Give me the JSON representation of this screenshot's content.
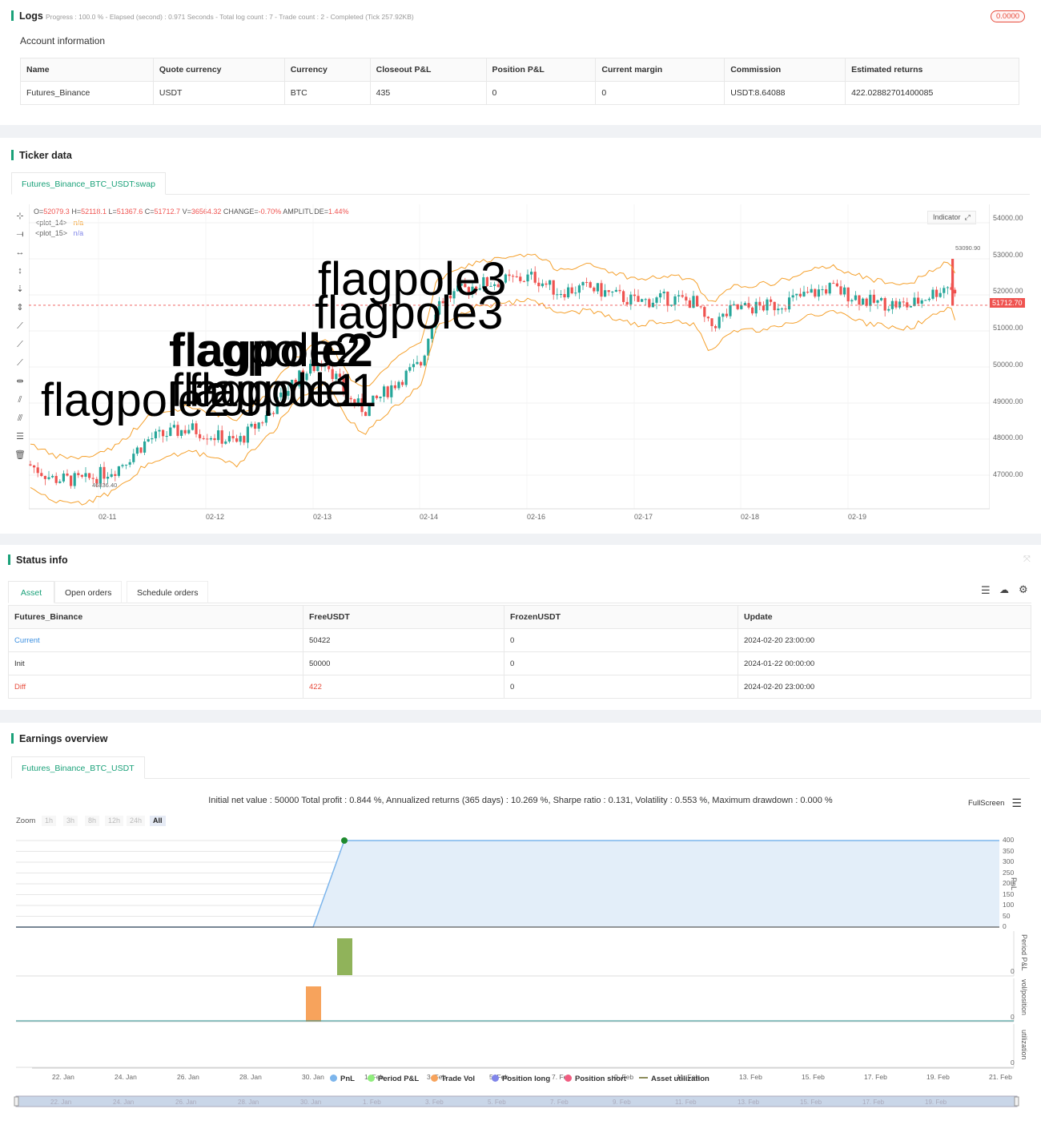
{
  "logs": {
    "title": "Logs",
    "progress": "Progress : 100.0 % - Elapsed (second) : 0.971 Seconds - Total log count : 7 - Trade count : 2 - Completed (Tick 257.92KB)",
    "badge": "0.0000"
  },
  "account": {
    "title": "Account information",
    "headers": [
      "Name",
      "Quote currency",
      "Currency",
      "Closeout P&L",
      "Position P&L",
      "Current margin",
      "Commission",
      "Estimated returns"
    ],
    "row": [
      "Futures_Binance",
      "USDT",
      "BTC",
      "435",
      "0",
      "0",
      "USDT:8.64088",
      "422.02882701400085"
    ]
  },
  "ticker": {
    "title": "Ticker data",
    "tab": "Futures_Binance_BTC_USDT:swap",
    "ohlc": {
      "prefix_o": "O=",
      "o": "52079.3",
      "prefix_h": " H=",
      "h": "52118.1",
      "prefix_l": " L=",
      "l": "51367.6",
      "prefix_c": " C=",
      "c": "51712.7",
      "prefix_v": " V=",
      "v": "36564.32",
      "prefix_change": " CHANGE=",
      "change": "-0.70%",
      "prefix_amp": " AMPLITUDE=",
      "amp": "1.44%"
    },
    "plots": [
      {
        "name": "<plot_14>",
        "value": "n/a"
      },
      {
        "name": "<plot_15>",
        "value": "n/a"
      }
    ],
    "indicator_btn": "Indicator",
    "price_ticks": [
      "54000.00",
      "53000.00",
      "52000.00",
      "51000.00",
      "50000.00",
      "49000.00",
      "48000.00",
      "47000.00"
    ],
    "last_price": "51712.70",
    "high_mark": "53090.90",
    "low_mark": "46836.40",
    "date_ticks": [
      "02-11",
      "02-12",
      "02-13",
      "02-14",
      "02-16",
      "02-17",
      "02-18",
      "02-19"
    ],
    "annotations": [
      "flagpole3",
      "flagpole3",
      "flagpole2",
      "flagpole2",
      "flagpole1",
      "flagpole1",
      "flagpole2"
    ],
    "colors": {
      "up": "#26a69a",
      "down": "#ef5350",
      "band": "#f5a12e",
      "last_price": "#ef5350"
    }
  },
  "status": {
    "title": "Status info",
    "tabs": [
      "Asset",
      "Open orders",
      "Schedule orders"
    ],
    "headers": [
      "Futures_Binance",
      "FreeUSDT",
      "FrozenUSDT",
      "Update"
    ],
    "rows": [
      [
        "Current",
        "50422",
        "0",
        "2024-02-20 23:00:00"
      ],
      [
        "Init",
        "50000",
        "0",
        "2024-01-22 00:00:00"
      ],
      [
        "Diff",
        "422",
        "0",
        "2024-02-20 23:00:00"
      ]
    ]
  },
  "earnings": {
    "title": "Earnings overview",
    "tab": "Futures_Binance_BTC_USDT",
    "summary": "Initial net value : 50000 Total profit : 0.844 %, Annualized returns (365 days) : 10.269 %, Sharpe ratio : 0.131, Volatility : 0.553 %, Maximum drawdown : 0.000 %",
    "fullscreen": "FullScreen",
    "zoom_label": "Zoom",
    "zoom_opts": [
      "1h",
      "3h",
      "8h",
      "12h",
      "24h",
      "All"
    ],
    "pnl_ticks": [
      "400",
      "350",
      "300",
      "250",
      "200",
      "150",
      "100",
      "50",
      "0"
    ],
    "axis_titles": [
      "PnL",
      "Period P&L",
      "vol/position",
      "utilization"
    ],
    "zero": "0",
    "date_ticks": [
      "22. Jan",
      "24. Jan",
      "26. Jan",
      "28. Jan",
      "30. Jan",
      "1. Feb",
      "3. Feb",
      "5. Feb",
      "7. Feb",
      "9. Feb",
      "11. Feb",
      "13. Feb",
      "15. Feb",
      "17. Feb",
      "19. Feb",
      "21. Feb"
    ],
    "nav_ticks": [
      "22. Jan",
      "24. Jan",
      "26. Jan",
      "28. Jan",
      "30. Jan",
      "1. Feb",
      "3. Feb",
      "5. Feb",
      "7. Feb",
      "9. Feb",
      "11. Feb",
      "13. Feb",
      "15. Feb",
      "17. Feb",
      "19. Feb"
    ],
    "legend": [
      {
        "name": "PnL",
        "color": "#7cb5ec"
      },
      {
        "name": "Period P&L",
        "color": "#90ed7d"
      },
      {
        "name": "Trade Vol",
        "color": "#f7a35c"
      },
      {
        "name": "Position long",
        "color": "#8085e9"
      },
      {
        "name": "Position short",
        "color": "#f15c80"
      },
      {
        "name": "Asset utilization",
        "color": "#8d8d5c"
      }
    ]
  },
  "chart_data": [
    {
      "type": "line",
      "title": "",
      "x": [
        "22. Jan",
        "30. Jan",
        "31. Jan",
        "21. Feb"
      ],
      "series": [
        {
          "name": "PnL",
          "values": [
            0,
            0,
            422,
            422
          ]
        }
      ],
      "ylim": [
        0,
        400
      ]
    },
    {
      "type": "bar",
      "series": [
        {
          "name": "Period P&L",
          "values": [
            422
          ]
        }
      ],
      "x": [
        "31. Jan"
      ]
    },
    {
      "type": "bar",
      "series": [
        {
          "name": "Trade Vol",
          "values": [
            1
          ]
        }
      ],
      "x": [
        "30. Jan"
      ]
    }
  ]
}
